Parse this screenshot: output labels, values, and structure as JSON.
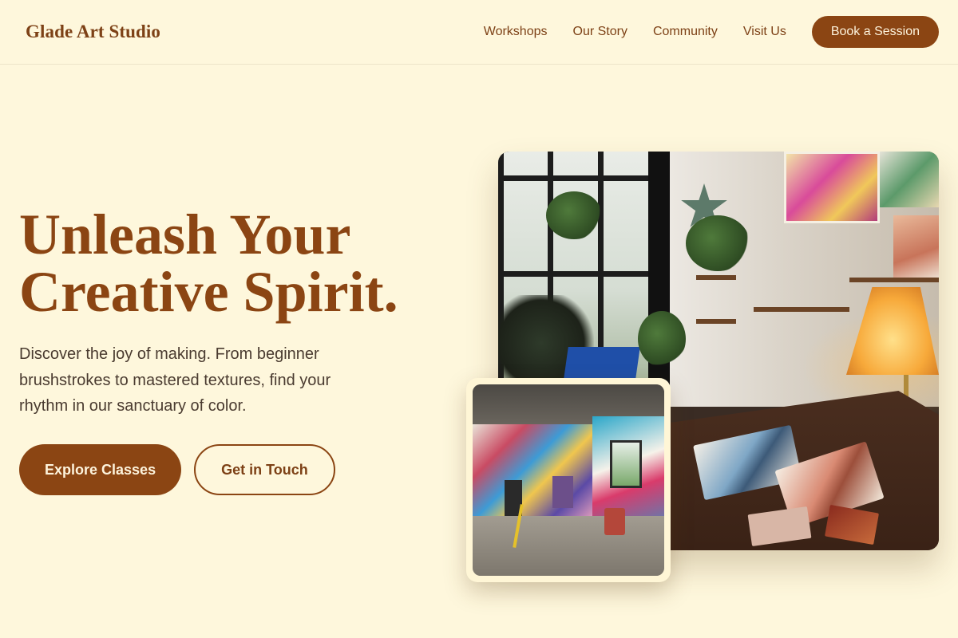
{
  "header": {
    "brand": "Glade Art Studio",
    "nav": [
      "Workshops",
      "Our Story",
      "Community",
      "Visit Us"
    ],
    "cta": "Book a Session"
  },
  "hero": {
    "title_line1": "Unleash Your",
    "title_line2": "Creative Spirit.",
    "description": "Discover the joy of making. From beginner brushstrokes to mastered textures, find your rhythm in our sanctuary of color.",
    "primary_button": "Explore Classes",
    "secondary_button": "Get in Touch"
  },
  "colors": {
    "background": "#fef7dc",
    "accent": "#8b4513",
    "brand_text": "#7d4116",
    "body_text": "#4a3b30",
    "button_text": "#fdf3dc"
  },
  "images": {
    "main": "art-studio-interior-photo",
    "inset": "graffiti-studio-photo"
  }
}
